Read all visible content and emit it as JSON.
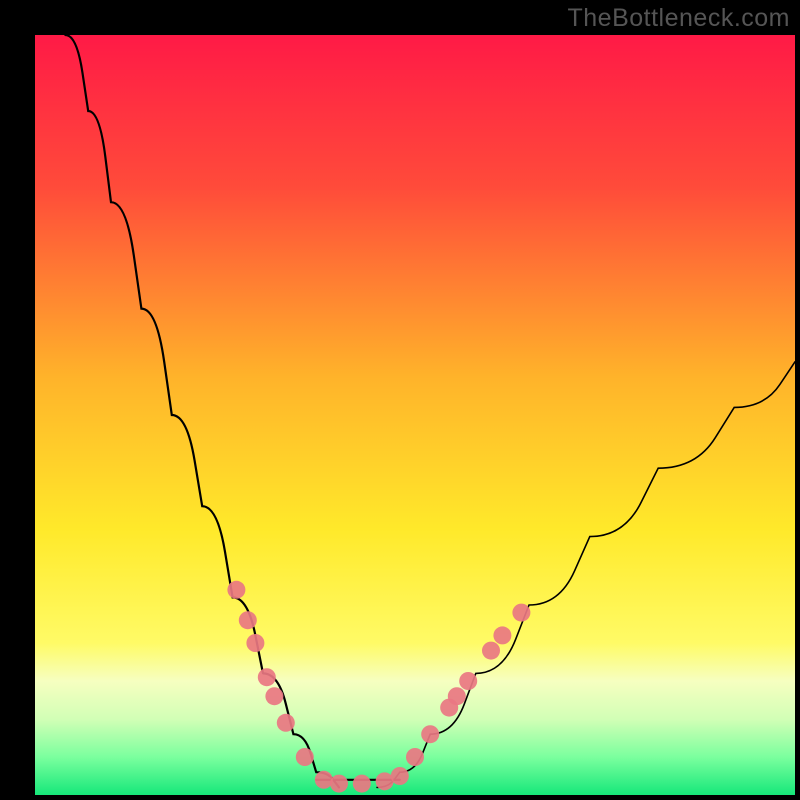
{
  "watermark": "TheBottleneck.com",
  "chart_data": {
    "type": "line",
    "title": "",
    "xlabel": "",
    "ylabel": "",
    "axes_visible": false,
    "xlim": [
      0,
      100
    ],
    "ylim": [
      0,
      100
    ],
    "optimum_x_range": [
      37,
      48
    ],
    "background_gradient": [
      {
        "stop": 0,
        "color": "#ff1a46"
      },
      {
        "stop": 20,
        "color": "#ff4b3a"
      },
      {
        "stop": 45,
        "color": "#ffb32a"
      },
      {
        "stop": 65,
        "color": "#ffe92a"
      },
      {
        "stop": 80,
        "color": "#fffb66"
      },
      {
        "stop": 85,
        "color": "#f6ffc0"
      },
      {
        "stop": 90,
        "color": "#d2ffb6"
      },
      {
        "stop": 95,
        "color": "#7bff9e"
      },
      {
        "stop": 100,
        "color": "#16e87a"
      }
    ],
    "series": [
      {
        "name": "left-curve",
        "values": [
          {
            "x": 4,
            "y": 100
          },
          {
            "x": 7,
            "y": 90
          },
          {
            "x": 10,
            "y": 78
          },
          {
            "x": 14,
            "y": 64
          },
          {
            "x": 18,
            "y": 50
          },
          {
            "x": 22,
            "y": 38
          },
          {
            "x": 26,
            "y": 26
          },
          {
            "x": 30,
            "y": 16
          },
          {
            "x": 34,
            "y": 8
          },
          {
            "x": 37,
            "y": 3
          },
          {
            "x": 40,
            "y": 1
          }
        ]
      },
      {
        "name": "bottom-flat",
        "values": [
          {
            "x": 37,
            "y": 2
          },
          {
            "x": 48,
            "y": 2
          }
        ]
      },
      {
        "name": "right-curve",
        "values": [
          {
            "x": 45,
            "y": 1
          },
          {
            "x": 48,
            "y": 3
          },
          {
            "x": 52,
            "y": 8
          },
          {
            "x": 58,
            "y": 16
          },
          {
            "x": 65,
            "y": 25
          },
          {
            "x": 73,
            "y": 34
          },
          {
            "x": 82,
            "y": 43
          },
          {
            "x": 92,
            "y": 51
          },
          {
            "x": 100,
            "y": 57
          }
        ]
      }
    ],
    "scatter": {
      "name": "markers",
      "color": "#e97782",
      "radius": 9,
      "points": [
        {
          "x": 26.5,
          "y": 27
        },
        {
          "x": 28,
          "y": 23
        },
        {
          "x": 29,
          "y": 20
        },
        {
          "x": 30.5,
          "y": 15.5
        },
        {
          "x": 31.5,
          "y": 13
        },
        {
          "x": 33,
          "y": 9.5
        },
        {
          "x": 35.5,
          "y": 5
        },
        {
          "x": 38,
          "y": 2
        },
        {
          "x": 40,
          "y": 1.5
        },
        {
          "x": 43,
          "y": 1.5
        },
        {
          "x": 46,
          "y": 1.8
        },
        {
          "x": 48,
          "y": 2.5
        },
        {
          "x": 50,
          "y": 5
        },
        {
          "x": 52,
          "y": 8
        },
        {
          "x": 54.5,
          "y": 11.5
        },
        {
          "x": 55.5,
          "y": 13
        },
        {
          "x": 57,
          "y": 15
        },
        {
          "x": 60,
          "y": 19
        },
        {
          "x": 61.5,
          "y": 21
        },
        {
          "x": 64,
          "y": 24
        }
      ]
    }
  }
}
